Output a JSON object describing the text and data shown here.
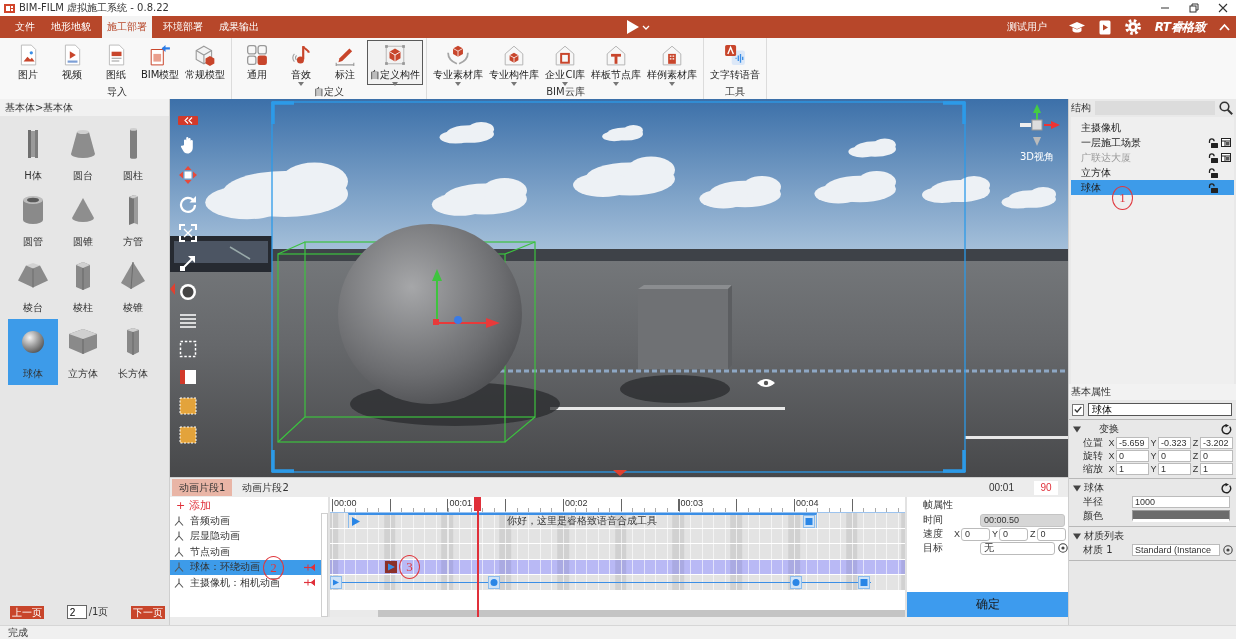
{
  "window": {
    "title": "BIM-FILM 虚拟施工系统 - 0.8.22"
  },
  "menu_tabs": [
    {
      "label": "文件",
      "selected": false
    },
    {
      "label": "地形地貌",
      "selected": false
    },
    {
      "label": "施工部署",
      "selected": true
    },
    {
      "label": "环境部署",
      "selected": false
    },
    {
      "label": "成果输出",
      "selected": false
    }
  ],
  "account": {
    "user": "测试用户",
    "brand": "RT睿格致"
  },
  "ribbon": [
    {
      "label": "导入",
      "items": [
        {
          "label": "图片",
          "dropdown": false,
          "selected": false
        },
        {
          "label": "视频",
          "dropdown": false,
          "selected": false
        },
        {
          "label": "图纸",
          "dropdown": false,
          "selected": false
        },
        {
          "label": "BIM模型",
          "dropdown": false,
          "selected": false
        },
        {
          "label": "常规模型",
          "dropdown": false,
          "selected": false
        }
      ]
    },
    {
      "label": "自定义",
      "items": [
        {
          "label": "通用",
          "dropdown": false,
          "selected": false
        },
        {
          "label": "音效",
          "dropdown": true,
          "selected": false
        },
        {
          "label": "标注",
          "dropdown": false,
          "selected": false
        },
        {
          "label": "自定义构件",
          "dropdown": true,
          "selected": true
        }
      ]
    },
    {
      "label": "BIM云库",
      "items": [
        {
          "label": "专业素材库",
          "dropdown": true,
          "selected": false
        },
        {
          "label": "专业构件库",
          "dropdown": true,
          "selected": false
        },
        {
          "label": "企业CI库",
          "dropdown": true,
          "selected": false
        },
        {
          "label": "样板节点库",
          "dropdown": true,
          "selected": false
        },
        {
          "label": "样例素材库",
          "dropdown": true,
          "selected": false
        }
      ]
    },
    {
      "label": "工具",
      "items": [
        {
          "label": "文字转语音",
          "dropdown": false,
          "selected": false
        }
      ]
    }
  ],
  "shape_library": {
    "breadcrumb": "基本体>基本体",
    "shapes": [
      {
        "label": "H体",
        "selected": false
      },
      {
        "label": "圆台",
        "selected": false
      },
      {
        "label": "圆柱",
        "selected": false
      },
      {
        "label": "圆管",
        "selected": false
      },
      {
        "label": "圆锥",
        "selected": false
      },
      {
        "label": "方管",
        "selected": false
      },
      {
        "label": "棱台",
        "selected": false
      },
      {
        "label": "棱柱",
        "selected": false
      },
      {
        "label": "棱锥",
        "selected": false
      },
      {
        "label": "球体",
        "selected": true
      },
      {
        "label": "立方体",
        "selected": false
      },
      {
        "label": "长方体",
        "selected": false
      }
    ],
    "pager": {
      "prev": "上一页",
      "page": "2",
      "total": "/1页",
      "next": "下一页"
    }
  },
  "viewport": {
    "view_label": "3D视角"
  },
  "timeline": {
    "clips": [
      {
        "label": "动画片段1",
        "selected": true
      },
      {
        "label": "动画片段2",
        "selected": false
      }
    ],
    "time": "00:01",
    "frame_value": "90",
    "add": "+ 添加",
    "tracks": [
      {
        "label": "音频动画",
        "kind": "audio",
        "selected": false,
        "pinned": false,
        "clip_text": "你好，这里是睿格致语音合成工具"
      },
      {
        "label": "层显隐动画",
        "kind": "layer",
        "selected": false,
        "pinned": false
      },
      {
        "label": "节点动画",
        "kind": "node",
        "selected": false,
        "pinned": false
      },
      {
        "label": "球体：环绕动画",
        "kind": "orbit",
        "selected": true,
        "pinned": true
      },
      {
        "label": "主摄像机：相机动画",
        "kind": "camera",
        "selected": false,
        "pinned": true
      }
    ],
    "ruler": [
      "00:00",
      "00:01",
      "00:02",
      "00:03",
      "00:04"
    ],
    "playhead": {
      "level": 0.257
    }
  },
  "frame_properties": {
    "title": "帧属性",
    "time": {
      "label": "时间",
      "value": "00:00.50",
      "disabled": true
    },
    "speed": {
      "label": "速度",
      "fields": [
        {
          "axis": "X",
          "value": "0"
        },
        {
          "axis": "Y",
          "value": "0"
        },
        {
          "axis": "Z",
          "value": "0"
        }
      ]
    },
    "target": {
      "label": "目标",
      "value": "无"
    },
    "confirm": "确定"
  },
  "structure": {
    "title": "结构",
    "items": [
      {
        "label": "主摄像机",
        "selected": false,
        "disabled": false,
        "lockable": false,
        "layers": false
      },
      {
        "label": "一层施工场景",
        "selected": false,
        "disabled": false,
        "lockable": true,
        "layers": true
      },
      {
        "label": "广联达大厦",
        "selected": false,
        "disabled": true,
        "lockable": true,
        "layers": true
      },
      {
        "label": "立方体",
        "selected": false,
        "disabled": false,
        "lockable": true,
        "layers": false
      },
      {
        "label": "球体",
        "selected": true,
        "disabled": false,
        "lockable": true,
        "layers": false
      }
    ]
  },
  "properties": {
    "title": "基本属性",
    "enabled": true,
    "name": "球体",
    "sections": [
      {
        "title": "变换",
        "kind": "vector",
        "expanded": true,
        "reset": true,
        "rows": [
          {
            "label": "位置",
            "values": [
              {
                "axis": "X",
                "value": "-5.659"
              },
              {
                "axis": "Y",
                "value": "-0.323"
              },
              {
                "axis": "Z",
                "value": "-3.202"
              }
            ]
          },
          {
            "label": "旋转",
            "values": [
              {
                "axis": "X",
                "value": "0"
              },
              {
                "axis": "Y",
                "value": "0"
              },
              {
                "axis": "Z",
                "value": "0"
              }
            ]
          },
          {
            "label": "缩放",
            "values": [
              {
                "axis": "X",
                "value": "1"
              },
              {
                "axis": "Y",
                "value": "1"
              },
              {
                "axis": "Z",
                "value": "1"
              }
            ]
          }
        ]
      },
      {
        "title": "球体",
        "kind": "fields",
        "expanded": true,
        "reset": true,
        "rows": [
          {
            "label": "半径",
            "kind": "text",
            "value": "1000"
          },
          {
            "label": "颜色",
            "kind": "color",
            "color": "#6b6b6b"
          }
        ]
      },
      {
        "title": "材质列表",
        "kind": "fields",
        "expanded": true,
        "reset": false,
        "rows": [
          {
            "label": "材质 1",
            "kind": "picker",
            "value": "Standard (Instance"
          }
        ]
      }
    ]
  },
  "annotations": [
    "1",
    "2",
    "3"
  ],
  "status_bar": "完成"
}
